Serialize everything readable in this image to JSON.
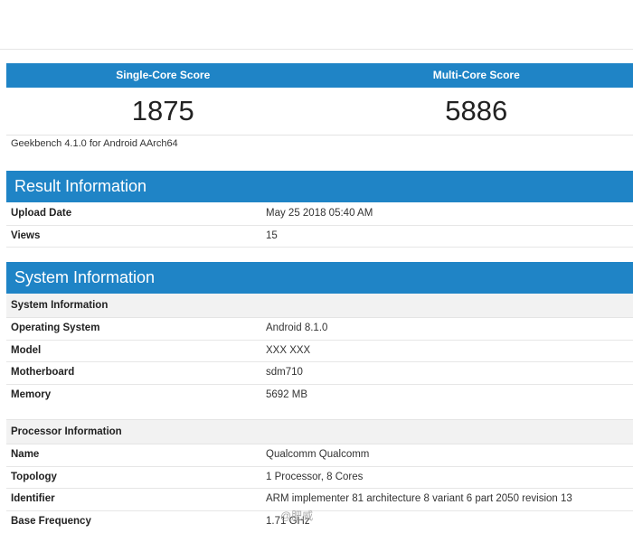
{
  "scores": {
    "single_label": "Single-Core Score",
    "multi_label": "Multi-Core Score",
    "single_value": "1875",
    "multi_value": "5886"
  },
  "version": "Geekbench 4.1.0 for Android AArch64",
  "result": {
    "title": "Result Information",
    "rows": [
      {
        "label": "Upload Date",
        "value": "May 25 2018 05:40 AM"
      },
      {
        "label": "Views",
        "value": "15"
      }
    ]
  },
  "system": {
    "title": "System Information",
    "sub1": "System Information",
    "rows1": [
      {
        "label": "Operating System",
        "value": "Android 8.1.0"
      },
      {
        "label": "Model",
        "value": "XXX XXX"
      },
      {
        "label": "Motherboard",
        "value": "sdm710"
      },
      {
        "label": "Memory",
        "value": "5692 MB"
      }
    ],
    "sub2": "Processor Information",
    "rows2": [
      {
        "label": "Name",
        "value": "Qualcomm Qualcomm"
      },
      {
        "label": "Topology",
        "value": "1 Processor, 8 Cores"
      },
      {
        "label": "Identifier",
        "value": "ARM implementer 81 architecture 8 variant 6 part 2050 revision 13"
      },
      {
        "label": "Base Frequency",
        "value": "1.71 GHz"
      }
    ]
  },
  "watermark": "@肥威"
}
